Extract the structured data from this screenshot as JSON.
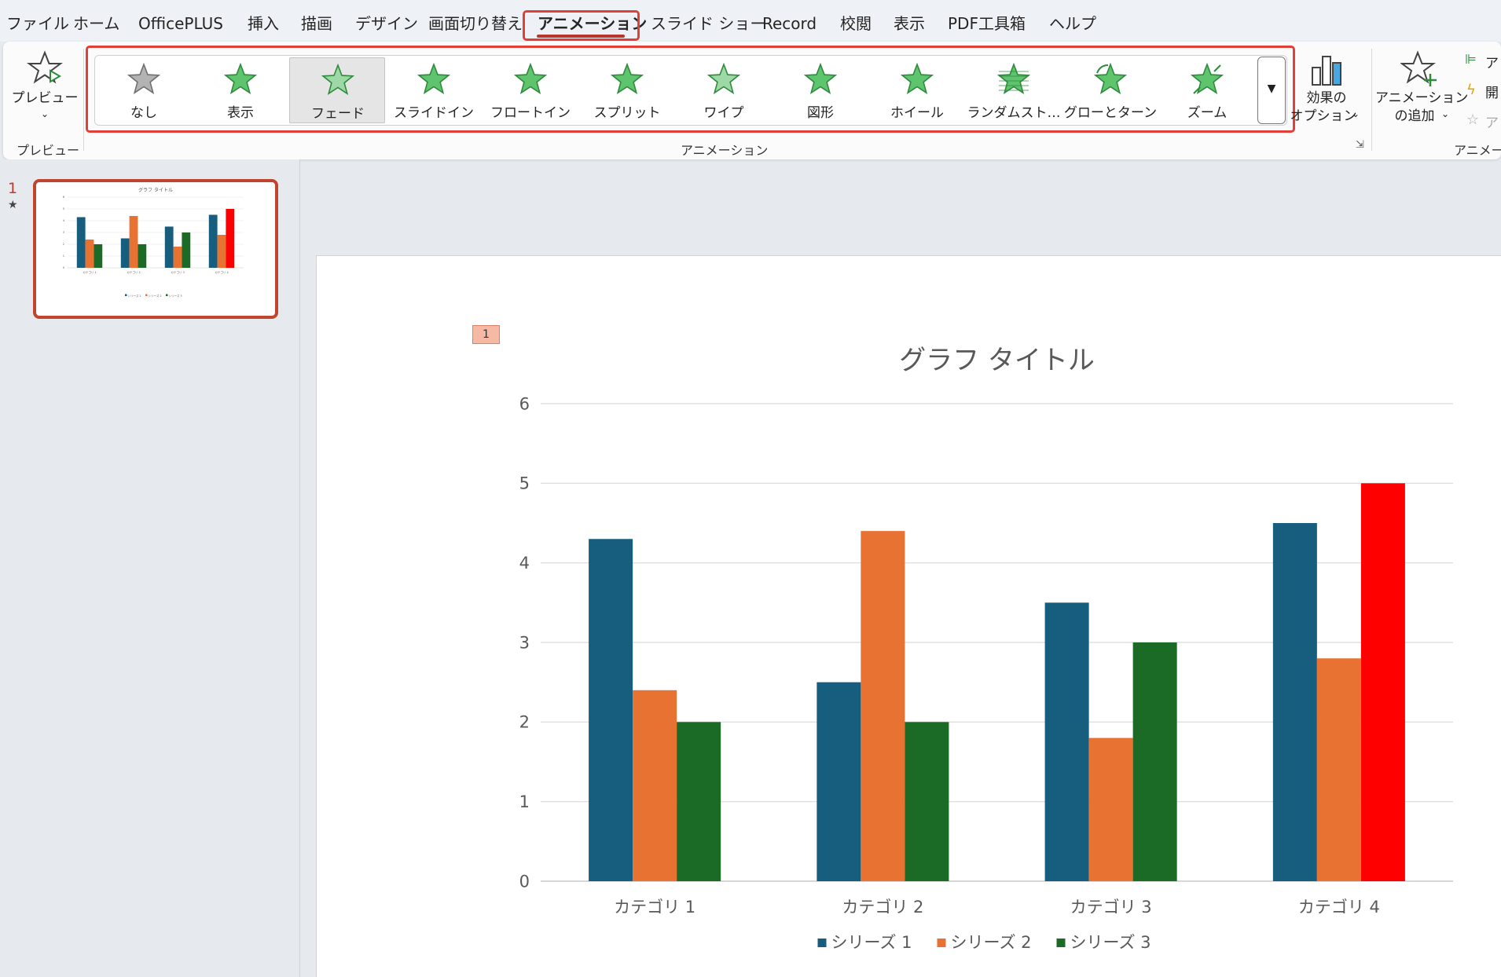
{
  "tabs": [
    {
      "label": "ファイル",
      "active": false
    },
    {
      "label": "ホーム",
      "active": false
    },
    {
      "label": "OfficePLUS",
      "active": false
    },
    {
      "label": "挿入",
      "active": false
    },
    {
      "label": "描画",
      "active": false
    },
    {
      "label": "デザイン",
      "active": false
    },
    {
      "label": "画面切り替え",
      "active": false
    },
    {
      "label": "アニメーション",
      "active": true
    },
    {
      "label": "スライド ショー",
      "active": false
    },
    {
      "label": "Record",
      "active": false
    },
    {
      "label": "校閲",
      "active": false
    },
    {
      "label": "表示",
      "active": false
    },
    {
      "label": "PDF工具箱",
      "active": false
    },
    {
      "label": "ヘルプ",
      "active": false
    }
  ],
  "ribbon": {
    "preview_button": "プレビュー",
    "preview_group": "プレビュー",
    "animation_group": "アニメーション",
    "effect_options_line1": "効果の",
    "effect_options_line2": "オプション",
    "add_animation_line1": "アニメーション",
    "add_animation_line2": "の追加",
    "advanced_group_partial": "アニメーシ",
    "right_item1_partial": "ア",
    "right_item2_partial": "開",
    "right_item3_partial": "ア",
    "gallery": [
      {
        "label": "なし",
        "icon": "star-none-icon",
        "selected": false
      },
      {
        "label": "表示",
        "icon": "star-appear-icon",
        "selected": false
      },
      {
        "label": "フェード",
        "icon": "star-fade-icon",
        "selected": true
      },
      {
        "label": "スライドイン",
        "icon": "star-fly-in-icon",
        "selected": false
      },
      {
        "label": "フロートイン",
        "icon": "star-float-in-icon",
        "selected": false
      },
      {
        "label": "スプリット",
        "icon": "star-split-icon",
        "selected": false
      },
      {
        "label": "ワイプ",
        "icon": "star-wipe-icon",
        "selected": false
      },
      {
        "label": "図形",
        "icon": "star-shape-icon",
        "selected": false
      },
      {
        "label": "ホイール",
        "icon": "star-wheel-icon",
        "selected": false
      },
      {
        "label": "ランダムスト…",
        "icon": "star-random-bars-icon",
        "selected": false
      },
      {
        "label": "グローとターン",
        "icon": "star-grow-turn-icon",
        "selected": false
      },
      {
        "label": "ズーム",
        "icon": "star-zoom-icon",
        "selected": false
      }
    ]
  },
  "slides_pane": {
    "slide_number": "1",
    "animation_marker": "★"
  },
  "slide": {
    "animation_tag": "1"
  },
  "colors": {
    "series1": "#175e7e",
    "series2": "#e87232",
    "series3": "#1b6b26",
    "highlight": "#ff0000",
    "accent": "#e04038"
  },
  "chart_data": {
    "type": "bar",
    "title": "グラフ タイトル",
    "categories": [
      "カテゴリ 1",
      "カテゴリ 2",
      "カテゴリ 3",
      "カテゴリ 4"
    ],
    "series": [
      {
        "name": "シリーズ 1",
        "values": [
          4.3,
          2.5,
          3.5,
          4.5
        ]
      },
      {
        "name": "シリーズ 2",
        "values": [
          2.4,
          4.4,
          1.8,
          2.8
        ]
      },
      {
        "name": "シリーズ 3",
        "values": [
          2,
          2,
          3,
          5
        ]
      }
    ],
    "highlighted_point": {
      "series": 2,
      "category": 3,
      "color": "#ff0000"
    },
    "ylim": [
      0,
      6
    ],
    "yticks": [
      "0",
      "1",
      "2",
      "3",
      "4",
      "5",
      "6"
    ],
    "grid": true,
    "legend": "bottom"
  }
}
